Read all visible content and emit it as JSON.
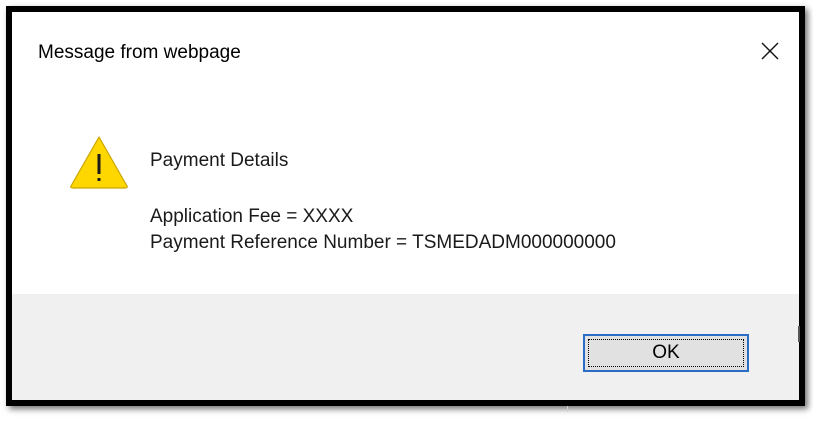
{
  "dialog": {
    "title": "Message from webpage",
    "close_icon": "close-icon",
    "icon": "warning-icon",
    "icon_color": "#ffd700",
    "message_heading": "Payment Details",
    "fee_label": "Application Fee = ",
    "fee_value": "XXXX",
    "reference_label": "Payment Reference Number = ",
    "reference_value": "TSMEDADM000000000",
    "ok_label": "OK",
    "accent_color": "#2b6cc4"
  }
}
